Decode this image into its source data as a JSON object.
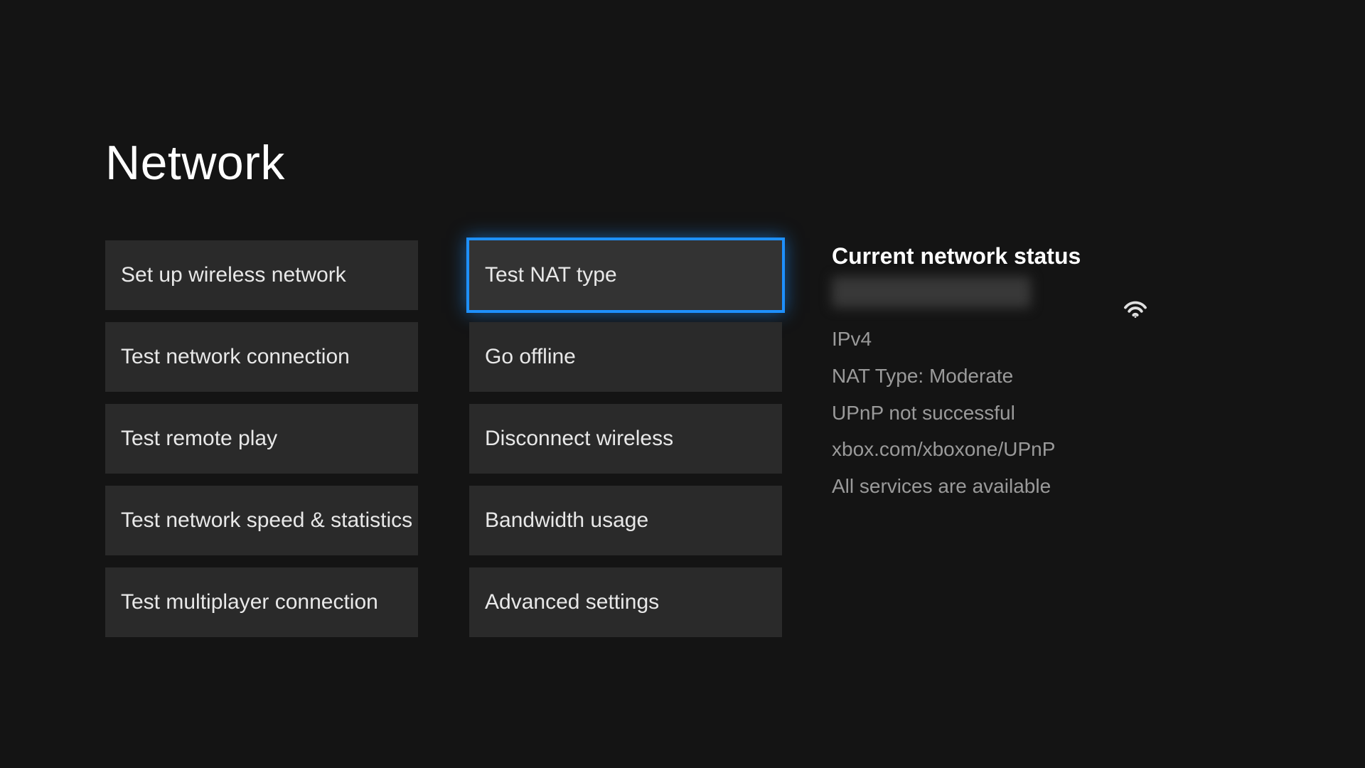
{
  "title": "Network",
  "leftColumn": [
    {
      "label": "Set up wireless network"
    },
    {
      "label": "Test network connection"
    },
    {
      "label": "Test remote play"
    },
    {
      "label": "Test network speed & statistics"
    },
    {
      "label": "Test multiplayer connection"
    }
  ],
  "rightColumn": [
    {
      "label": "Test NAT type",
      "selected": true
    },
    {
      "label": "Go offline"
    },
    {
      "label": "Disconnect wireless"
    },
    {
      "label": "Bandwidth usage"
    },
    {
      "label": "Advanced settings"
    }
  ],
  "status": {
    "heading": "Current network status",
    "lines": [
      "IPv4",
      "NAT Type: Moderate",
      "UPnP not successful",
      "xbox.com/xboxone/UPnP",
      "All services are available"
    ]
  }
}
